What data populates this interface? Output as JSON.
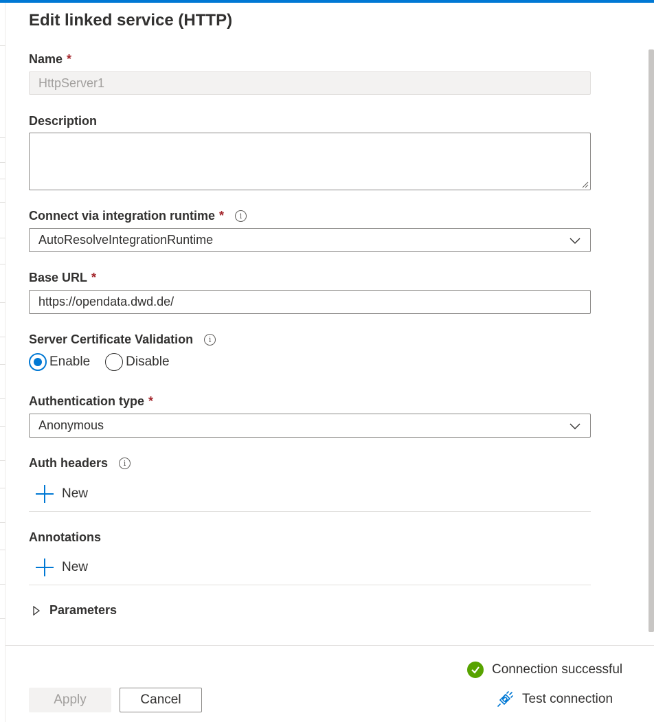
{
  "panel": {
    "title": "Edit linked service (HTTP)"
  },
  "fields": {
    "name": {
      "label": "Name",
      "required": "*",
      "value": "HttpServer1"
    },
    "description": {
      "label": "Description",
      "value": ""
    },
    "runtime": {
      "label": "Connect via integration runtime",
      "required": "*",
      "value": "AutoResolveIntegrationRuntime"
    },
    "base_url": {
      "label": "Base URL",
      "required": "*",
      "value": "https://opendata.dwd.de/"
    },
    "cert_validation": {
      "label": "Server Certificate Validation",
      "options": [
        "Enable",
        "Disable"
      ],
      "selected": "Enable"
    },
    "auth_type": {
      "label": "Authentication type",
      "required": "*",
      "value": "Anonymous"
    },
    "auth_headers": {
      "label": "Auth headers",
      "new_label": "New"
    },
    "annotations": {
      "label": "Annotations",
      "new_label": "New"
    },
    "parameters": {
      "label": "Parameters"
    }
  },
  "footer": {
    "status_text": "Connection successful",
    "apply_label": "Apply",
    "cancel_label": "Cancel",
    "test_label": "Test connection"
  },
  "colors": {
    "accent": "#0078d4",
    "success": "#57a300",
    "required": "#a4262c"
  },
  "icons": [
    "info-icon",
    "chevron-down-icon",
    "plus-icon",
    "caret-right-icon",
    "check-circle-icon",
    "plug-icon"
  ]
}
